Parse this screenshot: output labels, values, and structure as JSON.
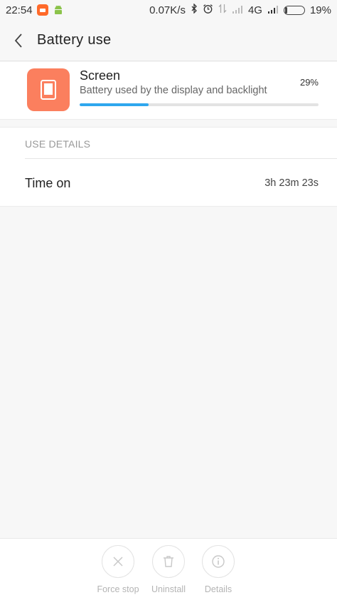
{
  "status_bar": {
    "time": "22:54",
    "network_speed": "0.07K/s",
    "network_type": "4G",
    "battery_percent": "19%",
    "battery_level": 0.19,
    "icons": [
      "mi-app-icon",
      "android-icon",
      "bluetooth-icon",
      "alarm-icon",
      "data-arrows-icon",
      "signal-icon",
      "signal-icon",
      "battery-icon"
    ]
  },
  "header": {
    "title": "Battery use",
    "back_icon": "chevron-left-icon"
  },
  "app": {
    "name": "Screen",
    "description": "Battery used by the display and backlight",
    "percent_label": "29%",
    "usage_fraction": 0.29,
    "icon": "phone-screen-icon",
    "icon_color": "#fb7f5e",
    "progress_color": "#2fa7ee"
  },
  "details": {
    "section_title": "USE DETAILS",
    "rows": [
      {
        "label": "Time on",
        "value": "3h 23m 23s"
      }
    ]
  },
  "actions": [
    {
      "label": "Force stop",
      "icon": "close-icon"
    },
    {
      "label": "Uninstall",
      "icon": "trash-icon"
    },
    {
      "label": "Details",
      "icon": "info-icon"
    }
  ]
}
